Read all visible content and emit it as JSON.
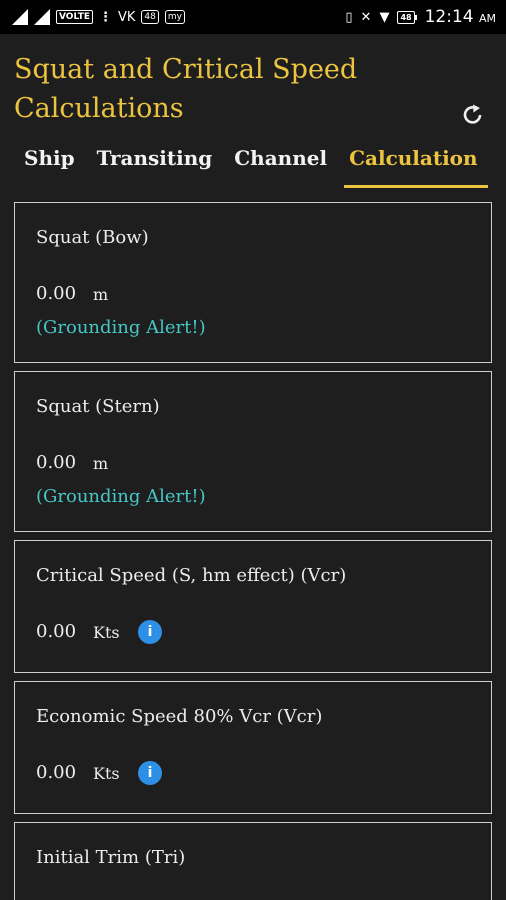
{
  "statusbar": {
    "volte": "VOLTE",
    "dots": "⋮",
    "vk": "VK",
    "badge": "48",
    "my": "my",
    "battery": "48",
    "time": "12:14",
    "ampm": "AM"
  },
  "header": {
    "title_line1": "Squat and Critical Speed",
    "title_line2": "Calculations"
  },
  "tabs": [
    {
      "label": "Ship"
    },
    {
      "label": "Transiting"
    },
    {
      "label": "Channel"
    },
    {
      "label": "Calculation"
    }
  ],
  "cards": [
    {
      "label": "Squat (Bow)",
      "value": "0.00",
      "unit": "m",
      "alert": "(Grounding Alert!)"
    },
    {
      "label": "Squat (Stern)",
      "value": "0.00",
      "unit": "m",
      "alert": "(Grounding Alert!)"
    },
    {
      "label": "Critical Speed (S, hm effect) (Vcr)",
      "value": "0.00",
      "unit": "Kts"
    },
    {
      "label": "Economic Speed 80% Vcr (Vcr)",
      "value": "0.00",
      "unit": "Kts"
    },
    {
      "label": "Initial Trim (Tri)"
    }
  ],
  "colors": {
    "accent": "#ecc440",
    "alert": "#47c6c6",
    "info": "#2e8fe6"
  },
  "icons": [
    "refresh-icon",
    "info-icon"
  ]
}
